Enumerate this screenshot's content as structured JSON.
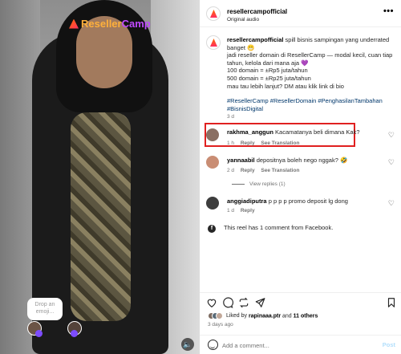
{
  "video": {
    "logo_left": "Reseller",
    "logo_right": "Camp",
    "emoji_placeholder": "Drop an emoji..."
  },
  "header": {
    "username": "resellercampofficial",
    "audio": "Original audio"
  },
  "caption": {
    "username": "resellercampofficial",
    "line1": "spill bisnis sampingan yang underrated banget 😬",
    "line2": "jadi reseller domain di ResellerCamp — modal kecil, cuan tiap tahun, kelola dari mana aja 💜",
    "line3": "100 domain = ±Rp5 juta/tahun",
    "line4": "500 domain = ±Rp25 juta/tahun",
    "line5": "mau tau lebih lanjut? DM atau klik link di bio",
    "hashtags": "#ResellerCamp #ResellerDomain #PenghasilanTambahan #BisnisDigital",
    "time": "3 d"
  },
  "comments": [
    {
      "user": "rakhma_anggun",
      "text": "Kacamatanya beli dimana Kak?",
      "time": "1 h",
      "reply": "Reply",
      "translate": "See Translation"
    },
    {
      "user": "yannaabil",
      "text": "depositnya boleh nego nggak? 🤣",
      "time": "2 d",
      "reply": "Reply",
      "translate": "See Translation",
      "view_replies": "View replies (1)"
    },
    {
      "user": "anggiadiputra",
      "text": "p p p p promo deposit lg dong",
      "time": "1 d",
      "reply": "Reply"
    }
  ],
  "facebook_note": "This reel has 1 comment from Facebook.",
  "likes": {
    "prefix": "Liked by",
    "user": "rapinaaa.ptr",
    "and": "and",
    "others": "11 others"
  },
  "posted": "3 days ago",
  "add_comment": {
    "placeholder": "Add a comment...",
    "post_label": "Post"
  },
  "colors": {
    "highlight": "#e02020",
    "link": "#00376b",
    "post_disabled": "#b2dffc"
  }
}
